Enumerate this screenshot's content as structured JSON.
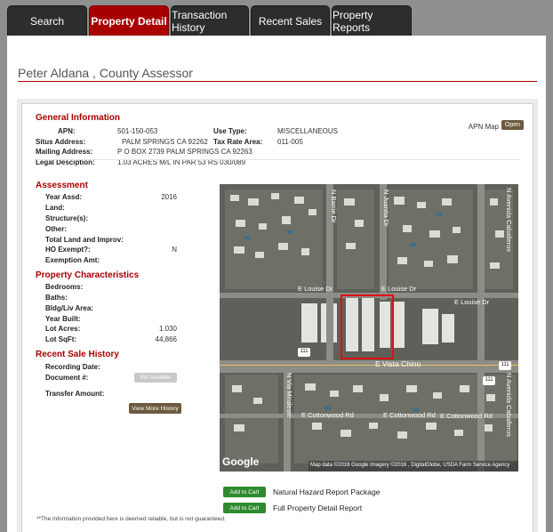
{
  "tabs": [
    {
      "label": "Search",
      "active": false
    },
    {
      "label": "Property Detail",
      "active": true
    },
    {
      "label": "Transaction History",
      "active": false
    },
    {
      "label": "Recent Sales",
      "active": false
    },
    {
      "label": "Property Reports",
      "active": false
    }
  ],
  "header": {
    "assessor": "Peter Aldana , County Assessor"
  },
  "general": {
    "title": "General Information",
    "apn_label": "APN:",
    "apn": "501-150-053",
    "situs_label": "Situs Address:",
    "situs": "PALM SPRINGS CA 92262",
    "mailing_label": "Mailing Address:",
    "mailing": "P O BOX 2739   PALM SPRINGS CA 92263",
    "legal_label": "Legal Desciption:",
    "legal": "1.03 ACRES M/L IN PAR 53 RS 030/089",
    "use_type_label": "Use Type:",
    "use_type": "MISCELLANEOUS",
    "tax_rate_label": "Tax Rate Area:",
    "tax_rate": "011-005",
    "apn_map_label": "APN Map",
    "open_label": "Open"
  },
  "assessment": {
    "title": "Assessment",
    "year_label": "Year Assd:",
    "year": "2016",
    "land_label": "Land:",
    "land": "",
    "structures_label": "Structure(s):",
    "structures": "",
    "other_label": "Other:",
    "other": "",
    "total_label": "Total Land and Improv:",
    "total": "",
    "ho_label": "HO Exempt?:",
    "ho": "N",
    "exemption_label": "Exemption Amt:",
    "exemption": ""
  },
  "characteristics": {
    "title": "Property Characteristics",
    "bedrooms_label": "Bedrooms:",
    "baths_label": "Baths:",
    "bldg_label": "Bldg/Liv Area:",
    "year_built_label": "Year Built:",
    "lot_acres_label": "Lot Acres:",
    "lot_acres": "1.030",
    "lot_sqft_label": "Lot SqFt:",
    "lot_sqft": "44,866"
  },
  "sales": {
    "title": "Recent Sale History",
    "recording_label": "Recording Date:",
    "document_label": "Document #:",
    "not_available": "Not Available",
    "transfer_label": "Transfer Amount:",
    "view_more": "View More History"
  },
  "map": {
    "streets": {
      "n_barrie": "N Barrie Dr",
      "n_juanita": "N Juanita Dr",
      "n_avenida": "N Avenida Caballeros",
      "e_louise_1": "E Louise Dr",
      "e_louise_2": "E Louise Dr",
      "e_louise_3": "E Louise Dr",
      "e_vista": "E Vista Chino",
      "n_via": "N Via Miraleste",
      "e_cottonwood_1": "E Cottonwood Rd",
      "e_cottonwood_2": "E Cottonwood Rd",
      "e_cottonwood_3": "E Cottonwood Rd",
      "n_avenida_2": "N Avenida Caballeros",
      "shield": "111"
    },
    "logo": "Google",
    "attribution": "Map data ©2016 Google  Imagery ©2016 , DigitalGlobe, USDA Farm Service Agency"
  },
  "reports": [
    {
      "button": "Add to Cart",
      "name": "Natural Hazard Report Package"
    },
    {
      "button": "Add to Cart",
      "name": "Full Property Detail Report"
    }
  ],
  "disclaimer": "**The information provided here is deemed reliable, but is not guaranteed.",
  "colors": {
    "accent": "#a80000",
    "tab_dark": "#2d2d2d",
    "button_brown": "#6b5a3d",
    "cart_green": "#2e8a2e"
  }
}
